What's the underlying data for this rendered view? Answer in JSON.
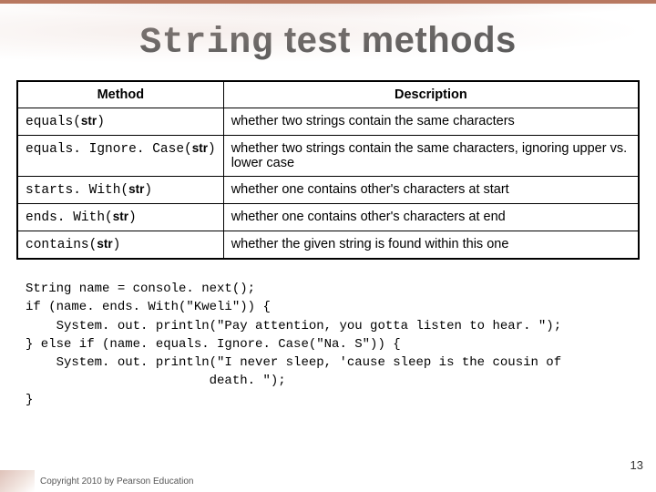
{
  "slide": {
    "title_mono": "String",
    "title_rest": " test methods"
  },
  "table": {
    "headers": {
      "method": "Method",
      "description": "Description"
    },
    "rows": [
      {
        "method_pre": "equals(",
        "method_arg": "str",
        "method_post": ")",
        "desc": "whether two strings contain the same characters"
      },
      {
        "method_pre": "equals. Ignore. Case(",
        "method_arg": "str",
        "method_post": ")",
        "desc": "whether two strings contain the same characters, ignoring upper vs. lower case"
      },
      {
        "method_pre": "starts. With(",
        "method_arg": "str",
        "method_post": ")",
        "desc": "whether one contains other's characters at start"
      },
      {
        "method_pre": "ends. With(",
        "method_arg": "str",
        "method_post": ")",
        "desc": "whether one contains other's characters at end"
      },
      {
        "method_pre": "contains(",
        "method_arg": "str",
        "method_post": ")",
        "desc": "whether the given string is found within this one"
      }
    ]
  },
  "code": "String name = console. next();\nif (name. ends. With(\"Kweli\")) {\n    System. out. println(\"Pay attention, you gotta listen to hear. \");\n} else if (name. equals. Ignore. Case(\"Na. S\")) {\n    System. out. println(\"I never sleep, 'cause sleep is the cousin of\n                        death. \");\n}",
  "footer": "Copyright 2010 by Pearson Education",
  "page": "13"
}
